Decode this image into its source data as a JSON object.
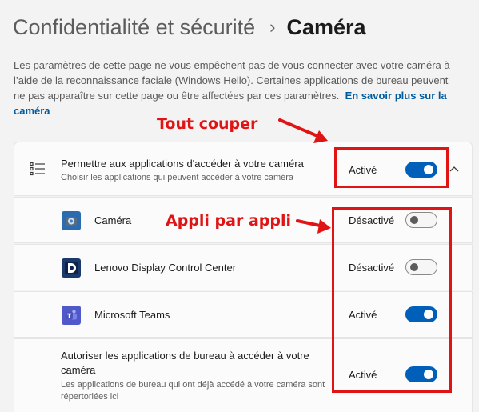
{
  "breadcrumb": {
    "parent": "Confidentialité et sécurité",
    "separator": "›",
    "current": "Caméra"
  },
  "intro": {
    "text": "Les paramètres de cette page ne vous empêchent pas de vous connecter avec votre caméra à l’aide de la reconnaissance faciale (Windows Hello). Certaines applications de bureau peuvent ne pas apparaître sur cette page ou être affectées par ces paramètres.",
    "link": "En savoir plus sur la caméra"
  },
  "main_setting": {
    "icon": "list-settings-icon",
    "title": "Permettre aux applications d'accéder à votre caméra",
    "subtitle": "Choisir les applications qui peuvent accéder à votre caméra",
    "state": "Activé",
    "on": true,
    "expand_icon": "chevron-up-icon"
  },
  "apps": [
    {
      "name": "Caméra",
      "icon": "camera-app-icon",
      "icon_color": "#2b6cb0",
      "state": "Désactivé",
      "on": false
    },
    {
      "name": "Lenovo Display Control Center",
      "icon": "lenovo-display-icon",
      "icon_color": "#1a3a6b",
      "state": "Désactivé",
      "on": false
    },
    {
      "name": "Microsoft Teams",
      "icon": "teams-icon",
      "icon_color": "#5059c9",
      "state": "Activé",
      "on": true
    }
  ],
  "desktop_apps": {
    "title": "Autoriser les applications de bureau à accéder à votre caméra",
    "subtitle": "Les applications de bureau qui ont déjà accédé à votre caméra sont répertoriées ici",
    "state": "Activé",
    "on": true
  },
  "annotations": {
    "top": "Tout couper",
    "apps": "Appli par appli",
    "color": "#e01414"
  },
  "colors": {
    "accent": "#005fb8",
    "link": "#005a9e"
  }
}
